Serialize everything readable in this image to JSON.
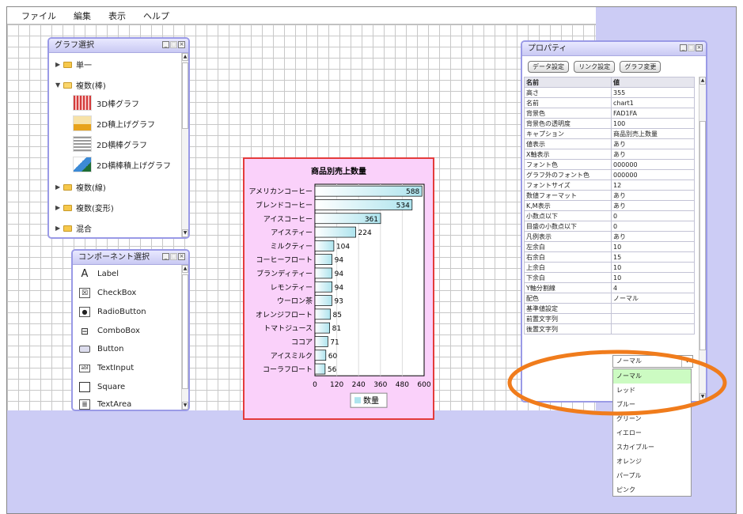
{
  "menu": [
    "ファイル",
    "編集",
    "表示",
    "ヘルプ"
  ],
  "graph_panel": {
    "title": "グラフ選択",
    "folders": [
      {
        "label": "単一",
        "expanded": false
      },
      {
        "label": "複数(棒)",
        "expanded": true
      },
      {
        "label": "複数(線)",
        "expanded": false
      },
      {
        "label": "複数(変形)",
        "expanded": false
      },
      {
        "label": "混合",
        "expanded": false
      }
    ],
    "items": [
      "3D棒グラフ",
      "2D積上げグラフ",
      "2D横棒グラフ",
      "2D横棒積上げグラフ"
    ]
  },
  "component_panel": {
    "title": "コンポーネント選択",
    "items": [
      {
        "label": "Label",
        "icon": "label-icon"
      },
      {
        "label": "CheckBox",
        "icon": "checkbox-icon"
      },
      {
        "label": "RadioButton",
        "icon": "radiobutton-icon"
      },
      {
        "label": "ComboBox",
        "icon": "combobox-icon"
      },
      {
        "label": "Button",
        "icon": "button-icon"
      },
      {
        "label": "TextInput",
        "icon": "textinput-icon"
      },
      {
        "label": "Square",
        "icon": "square-icon"
      },
      {
        "label": "TextArea",
        "icon": "textarea-icon"
      }
    ]
  },
  "chart_data": {
    "type": "bar",
    "orientation": "horizontal",
    "title": "商品別売上数量",
    "categories": [
      "アメリカンコーヒー",
      "ブレンドコーヒー",
      "アイスコーヒー",
      "アイスティー",
      "ミルクティー",
      "コーヒーフロート",
      "ブランディティー",
      "レモンティー",
      "ウーロン茶",
      "オレンジフロート",
      "トマトジュース",
      "ココア",
      "アイスミルク",
      "コーラフロート"
    ],
    "series": [
      {
        "name": "数量",
        "values": [
          588,
          534,
          361,
          224,
          104,
          94,
          94,
          94,
          93,
          85,
          81,
          71,
          60,
          56
        ]
      }
    ],
    "xlim": [
      0,
      600
    ],
    "xticks": [
      "0",
      "120",
      "240",
      "360",
      "480",
      "600"
    ],
    "legend": "bottom",
    "background": "#fad1fa",
    "bar_color": "#aee4ee"
  },
  "properties": {
    "title": "プロパティ",
    "buttons": [
      "データ設定",
      "リンク設定",
      "グラフ変更"
    ],
    "header": {
      "name": "名前",
      "value": "値"
    },
    "rows": [
      {
        "name": "高さ",
        "value": "355"
      },
      {
        "name": "名前",
        "value": "chart1"
      },
      {
        "name": "背景色",
        "value": "FAD1FA"
      },
      {
        "name": "背景色の透明度",
        "value": "100"
      },
      {
        "name": "キャプション",
        "value": "商品別売上数量"
      },
      {
        "name": "値表示",
        "value": "あり"
      },
      {
        "name": "X軸表示",
        "value": "あり"
      },
      {
        "name": "フォント色",
        "value": "000000"
      },
      {
        "name": "グラフ外のフォント色",
        "value": "000000"
      },
      {
        "name": "フォントサイズ",
        "value": "12"
      },
      {
        "name": "数値フォーマット",
        "value": "あり"
      },
      {
        "name": "K,M表示",
        "value": "あり"
      },
      {
        "name": "小数点以下",
        "value": "0"
      },
      {
        "name": "目盛の小数点以下",
        "value": "0"
      },
      {
        "name": "凡例表示",
        "value": "あり"
      },
      {
        "name": "左余白",
        "value": "10"
      },
      {
        "name": "右余白",
        "value": "15"
      },
      {
        "name": "上余白",
        "value": "10"
      },
      {
        "name": "下余白",
        "value": "10"
      },
      {
        "name": "Y軸分割線",
        "value": "4"
      },
      {
        "name": "配色",
        "value": "ノーマル"
      },
      {
        "name": "基準値設定",
        "value": ""
      },
      {
        "name": "前置文字列",
        "value": ""
      },
      {
        "name": "後置文字列",
        "value": ""
      }
    ]
  },
  "color_dropdown": {
    "selected": "ノーマル",
    "options": [
      "ノーマル",
      "レッド",
      "ブルー",
      "グリーン",
      "イエロー",
      "スカイブルー",
      "オレンジ",
      "パープル",
      "ピンク"
    ]
  },
  "colors": {
    "accent": "#9a9ae6",
    "highlight_oval": "#f07c1c",
    "selected_option": "#ccfbc2"
  }
}
